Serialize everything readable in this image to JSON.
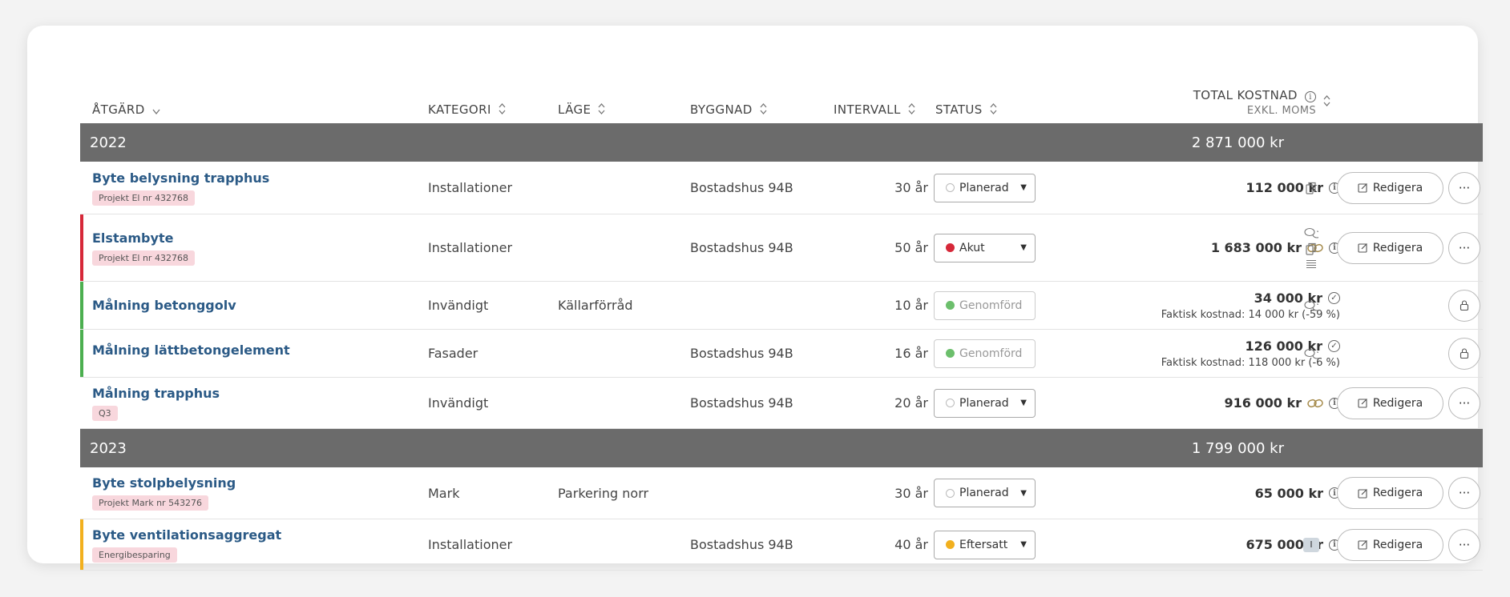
{
  "header": {
    "col_action": "ÅTGÄRD",
    "col_category": "KATEGORI",
    "col_location": "LÄGE",
    "col_building": "BYGGNAD",
    "col_interval": "INTERVALL",
    "col_status": "STATUS",
    "col_cost": "TOTAL KOSTNAD",
    "col_cost_sub": "EXKL. MOMS"
  },
  "groups": [
    {
      "year": "2022",
      "total": "2 871 000 kr",
      "rows": [
        {
          "title": "Byte belysning trapphus",
          "tag": "Projekt El nr 432768",
          "category": "Installationer",
          "location": "",
          "building": "Bostadshus 94B",
          "interval": "30 år",
          "status": "Planerad",
          "cost": "112 000 kr",
          "cost_sub": "",
          "edit": "Redigera"
        },
        {
          "title": "Elstambyte",
          "tag": "Projekt El nr 432768",
          "category": "Installationer",
          "location": "",
          "building": "Bostadshus 94B",
          "interval": "50 år",
          "status": "Akut",
          "cost": "1 683 000 kr",
          "cost_sub": "",
          "edit": "Redigera"
        },
        {
          "title": "Målning betonggolv",
          "tag": "",
          "category": "Invändigt",
          "location": "Källarförråd",
          "building": "",
          "interval": "10 år",
          "status": "Genomförd",
          "cost": "34 000 kr",
          "cost_sub": "Faktisk kostnad: 14 000 kr (-59 %)",
          "edit": ""
        },
        {
          "title": "Målning lättbetongelement",
          "tag": "",
          "category": "Fasader",
          "location": "",
          "building": "Bostadshus 94B",
          "interval": "16 år",
          "status": "Genomförd",
          "cost": "126 000 kr",
          "cost_sub": "Faktisk kostnad: 118 000 kr (-6 %)",
          "edit": ""
        },
        {
          "title": "Målning trapphus",
          "tag": "Q3",
          "category": "Invändigt",
          "location": "",
          "building": "Bostadshus 94B",
          "interval": "20 år",
          "status": "Planerad",
          "cost": "916 000 kr",
          "cost_sub": "",
          "edit": "Redigera"
        }
      ]
    },
    {
      "year": "2023",
      "total": "1 799 000 kr",
      "rows": [
        {
          "title": "Byte stolpbelysning",
          "tag": "Projekt Mark nr 543276",
          "category": "Mark",
          "location": "Parkering norr",
          "building": "",
          "interval": "30 år",
          "status": "Planerad",
          "cost": "65 000 kr",
          "cost_sub": "",
          "edit": "Redigera"
        },
        {
          "title": "Byte ventilationsaggregat",
          "tag": "Energibesparing",
          "category": "Installationer",
          "location": "",
          "building": "Bostadshus 94B",
          "interval": "40 år",
          "status": "Eftersatt",
          "cost": "675 000 kr",
          "cost_sub": "",
          "edit": "Redigera"
        }
      ]
    }
  ],
  "badge_label": "I",
  "more_label": "···",
  "colors": {
    "year_bar": "#6b6b6b",
    "title_link": "#2b5a86",
    "tag_bg": "#f8d7dd",
    "akut": "#d62839",
    "genomford": "#6cbf6c",
    "eftersatt": "#f2b01e",
    "accent_red": "#d62839",
    "accent_green": "#4caf50",
    "accent_yellow": "#f2b01e"
  }
}
